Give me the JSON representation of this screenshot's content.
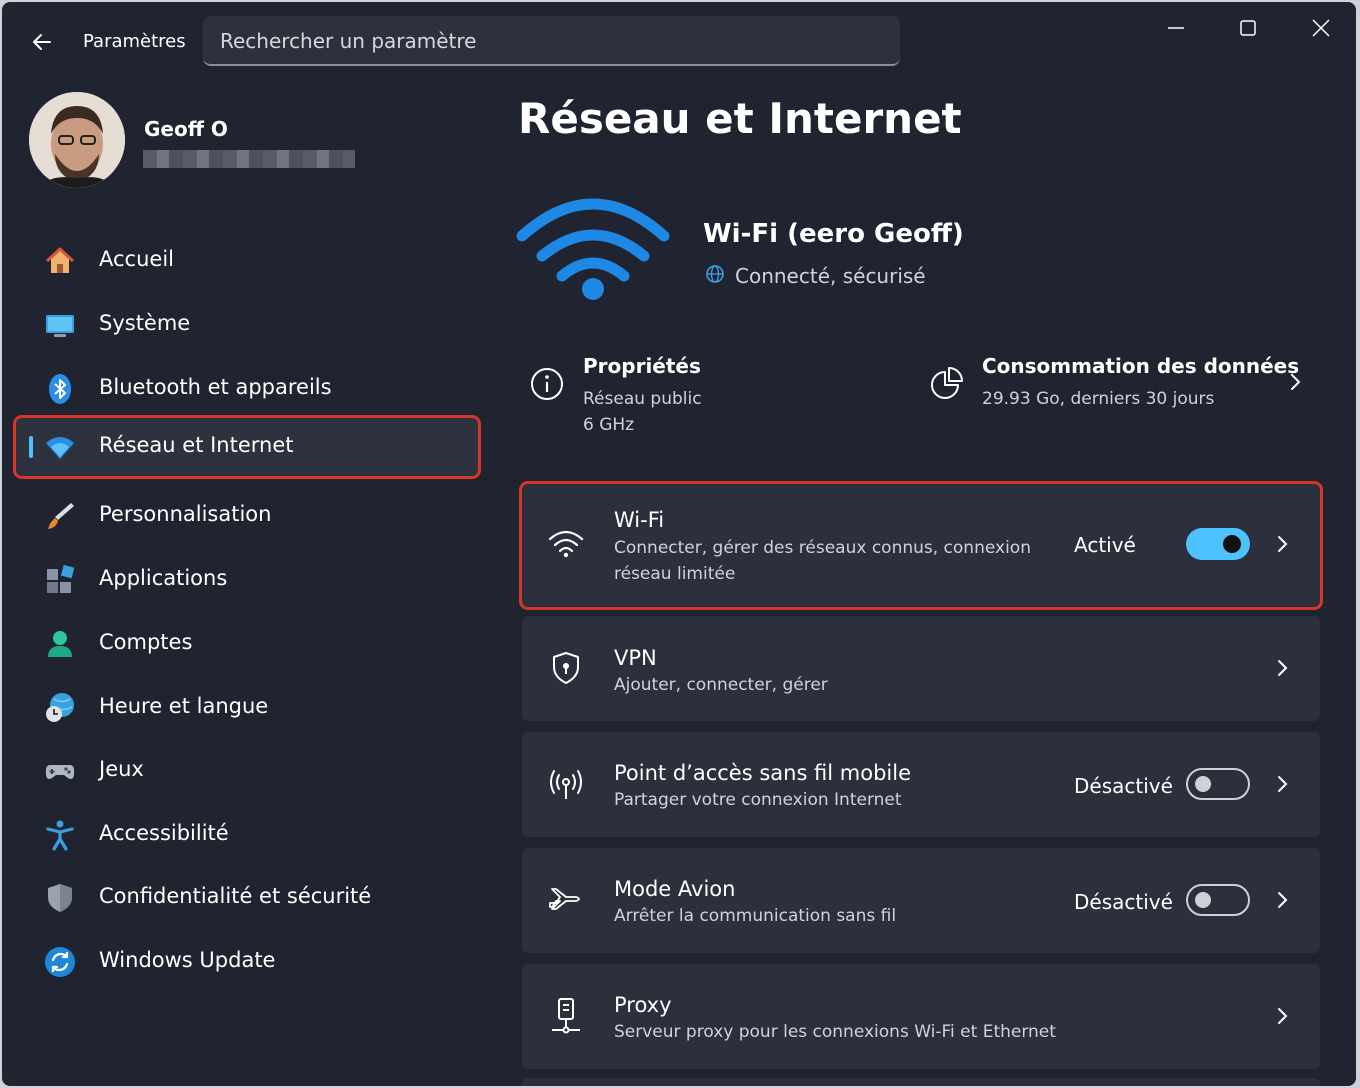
{
  "titlebar": {
    "app_title": "Paramètres",
    "search_placeholder": "Rechercher un paramètre"
  },
  "profile": {
    "name": "Geoff O"
  },
  "sidebar": {
    "items": [
      {
        "label": "Accueil",
        "icon": "home-icon"
      },
      {
        "label": "Système",
        "icon": "monitor-icon"
      },
      {
        "label": "Bluetooth et appareils",
        "icon": "bluetooth-icon"
      },
      {
        "label": "Réseau et Internet",
        "icon": "wifi-icon",
        "selected": true
      },
      {
        "label": "Personnalisation",
        "icon": "brush-icon"
      },
      {
        "label": "Applications",
        "icon": "apps-icon"
      },
      {
        "label": "Comptes",
        "icon": "person-icon"
      },
      {
        "label": "Heure et langue",
        "icon": "globe-clock-icon"
      },
      {
        "label": "Jeux",
        "icon": "gamepad-icon"
      },
      {
        "label": "Accessibilité",
        "icon": "accessibility-icon"
      },
      {
        "label": "Confidentialité et sécurité",
        "icon": "shield-icon"
      },
      {
        "label": "Windows Update",
        "icon": "update-icon"
      }
    ]
  },
  "main": {
    "title": "Réseau et Internet",
    "connection": {
      "name": "Wi-Fi (eero Geoff)",
      "status": "Connecté, sécurisé"
    },
    "properties": {
      "title": "Propriétés",
      "line1": "Réseau public",
      "line2": "6 GHz"
    },
    "data_usage": {
      "title": "Consommation des données",
      "subtitle": "29.93 Go, derniers 30 jours"
    },
    "cards": [
      {
        "title": "Wi-Fi",
        "subtitle": "Connecter, gérer des réseaux connus, connexion réseau limitée",
        "state": "Activé",
        "toggle": true
      },
      {
        "title": "VPN",
        "subtitle": "Ajouter, connecter, gérer"
      },
      {
        "title": "Point d’accès sans fil mobile",
        "subtitle": "Partager votre connexion Internet",
        "state": "Désactivé",
        "toggle": false
      },
      {
        "title": "Mode Avion",
        "subtitle": "Arrêter la communication sans fil",
        "state": "Désactivé",
        "toggle": false
      },
      {
        "title": "Proxy",
        "subtitle": "Serveur proxy pour les connexions Wi-Fi et Ethernet"
      }
    ]
  },
  "colors": {
    "accent": "#4cc2ff",
    "highlight": "#d8352a",
    "background": "#1f2430",
    "card": "#2b303c"
  }
}
